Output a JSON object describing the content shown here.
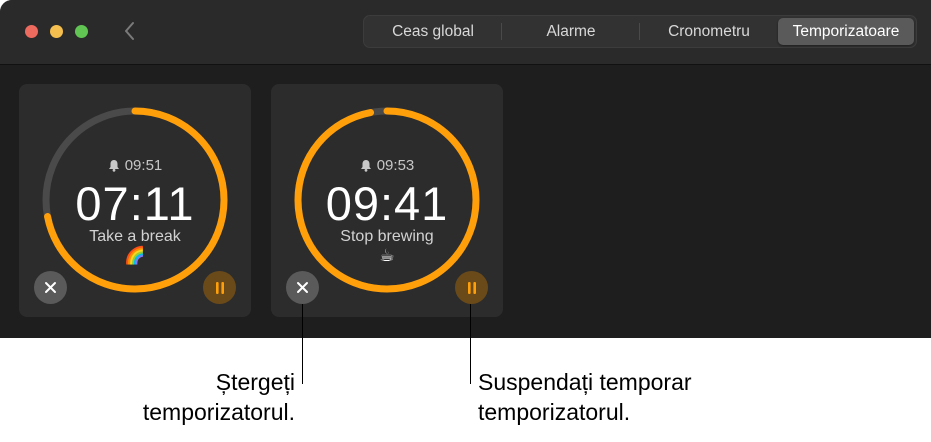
{
  "tabs": [
    {
      "label": "Ceas global",
      "active": false
    },
    {
      "label": "Alarme",
      "active": false
    },
    {
      "label": "Cronometru",
      "active": false
    },
    {
      "label": "Temporizatoare",
      "active": true
    }
  ],
  "timers": [
    {
      "alarm_time": "09:51",
      "remaining": "07:11",
      "label": "Take a break",
      "emoji": "🌈",
      "progress_remaining": 0.72
    },
    {
      "alarm_time": "09:53",
      "remaining": "09:41",
      "label": "Stop brewing",
      "emoji": "☕",
      "progress_remaining": 0.97
    }
  ],
  "callouts": {
    "cancel": [
      "Ștergeți",
      "temporizatorul."
    ],
    "pause": [
      "Suspendați temporar",
      "temporizatorul."
    ]
  },
  "colors": {
    "accent": "#ff9f0a",
    "track": "#4a4a4a",
    "pause_bg": "#6b4a1a",
    "cancel_bg": "#5a5a5a"
  },
  "icons": {
    "back": "chevron-left-icon",
    "bell": "bell-icon",
    "cancel": "x-icon",
    "pause": "pause-icon"
  }
}
